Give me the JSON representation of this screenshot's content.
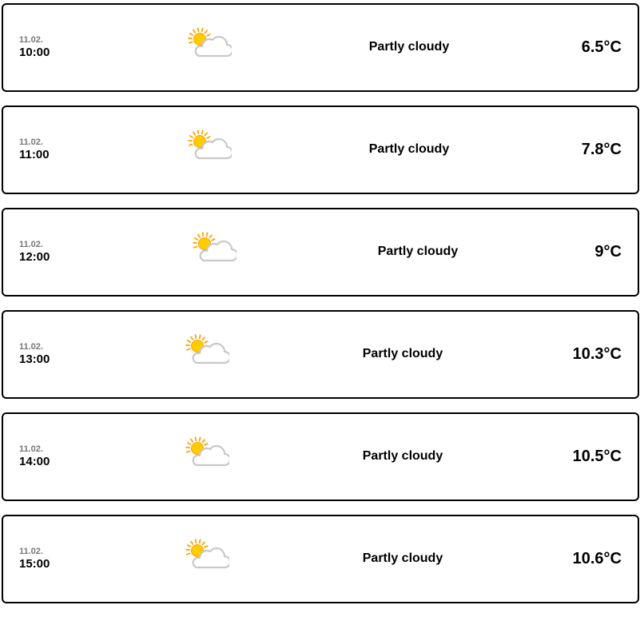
{
  "forecast": [
    {
      "date": "11.02.",
      "time": "10:00",
      "icon": "partly-cloudy-icon",
      "condition": "Partly cloudy",
      "temperature": "6.5°C"
    },
    {
      "date": "11.02.",
      "time": "11:00",
      "icon": "partly-cloudy-icon",
      "condition": "Partly cloudy",
      "temperature": "7.8°C"
    },
    {
      "date": "11.02.",
      "time": "12:00",
      "icon": "partly-cloudy-icon",
      "condition": "Partly cloudy",
      "temperature": "9°C"
    },
    {
      "date": "11.02.",
      "time": "13:00",
      "icon": "partly-cloudy-icon",
      "condition": "Partly cloudy",
      "temperature": "10.3°C"
    },
    {
      "date": "11.02.",
      "time": "14:00",
      "icon": "partly-cloudy-icon",
      "condition": "Partly cloudy",
      "temperature": "10.5°C"
    },
    {
      "date": "11.02.",
      "time": "15:00",
      "icon": "partly-cloudy-icon",
      "condition": "Partly cloudy",
      "temperature": "10.6°C"
    }
  ],
  "colors": {
    "sun": "#ffcc00",
    "sun_rays": "#ffa200",
    "cloud_fill": "#ffffff",
    "cloud_stroke": "#c8c8c8",
    "date_text": "#777777",
    "border": "#000000"
  }
}
